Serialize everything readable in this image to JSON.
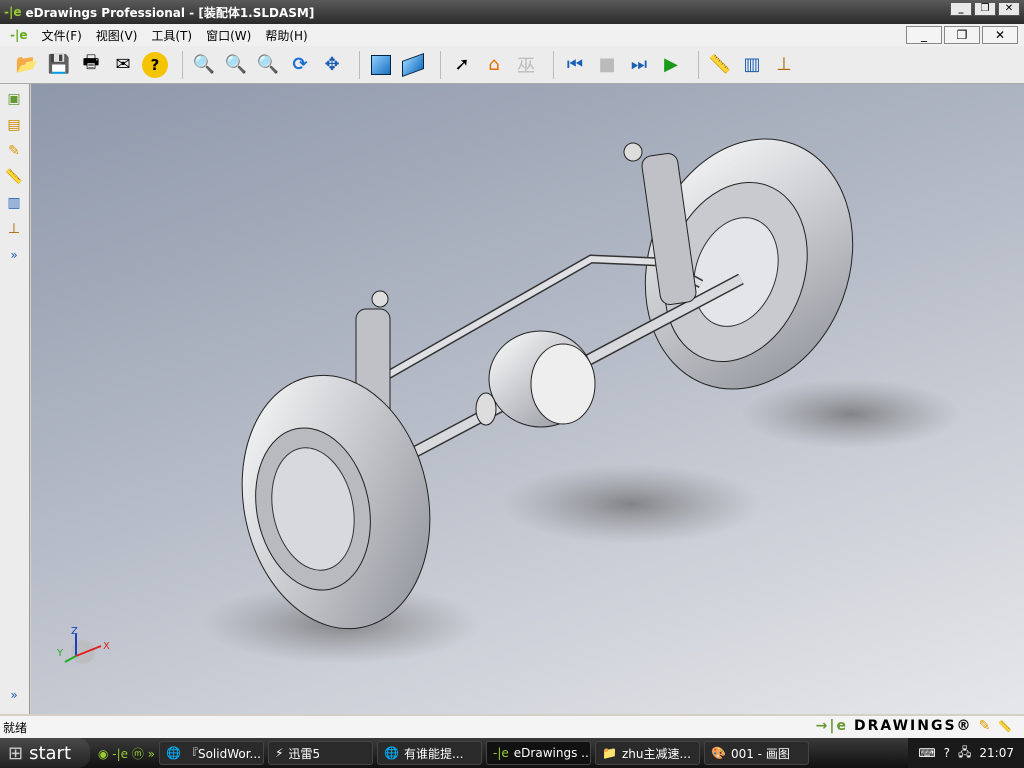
{
  "window": {
    "title": "eDrawings Professional - [装配体1.SLDASM]",
    "logo": "-|e"
  },
  "menu": {
    "items": [
      "文件(F)",
      "视图(V)",
      "工具(T)",
      "窗口(W)",
      "帮助(H)"
    ],
    "logo": "-|e"
  },
  "toolbar": {
    "icons": [
      "open-folder",
      "save",
      "print",
      "email",
      "help",
      "zoom-to-fit",
      "zoom-area",
      "zoom-in-out",
      "rotate",
      "pan",
      "shaded",
      "perspective",
      "select",
      "home",
      "explode",
      "first-frame",
      "stop",
      "next-frame",
      "play",
      "measure",
      "section",
      "stamp"
    ]
  },
  "status": {
    "text": "就绪",
    "brand": "DRAWINGS®",
    "brand_logo": "→|e"
  },
  "triad": {
    "z": "Z",
    "x": "X",
    "y": "Y"
  },
  "taskbar": {
    "start": "start",
    "tasks": [
      "『SolidWor...",
      "迅雷5",
      "有谁能提...",
      "eDrawings ...",
      "zhu主减速...",
      "001 - 画图"
    ],
    "clock": "21:07"
  },
  "colors": {
    "viewport_top": "#8e98ab",
    "viewport_bottom": "#e6e7ea"
  }
}
